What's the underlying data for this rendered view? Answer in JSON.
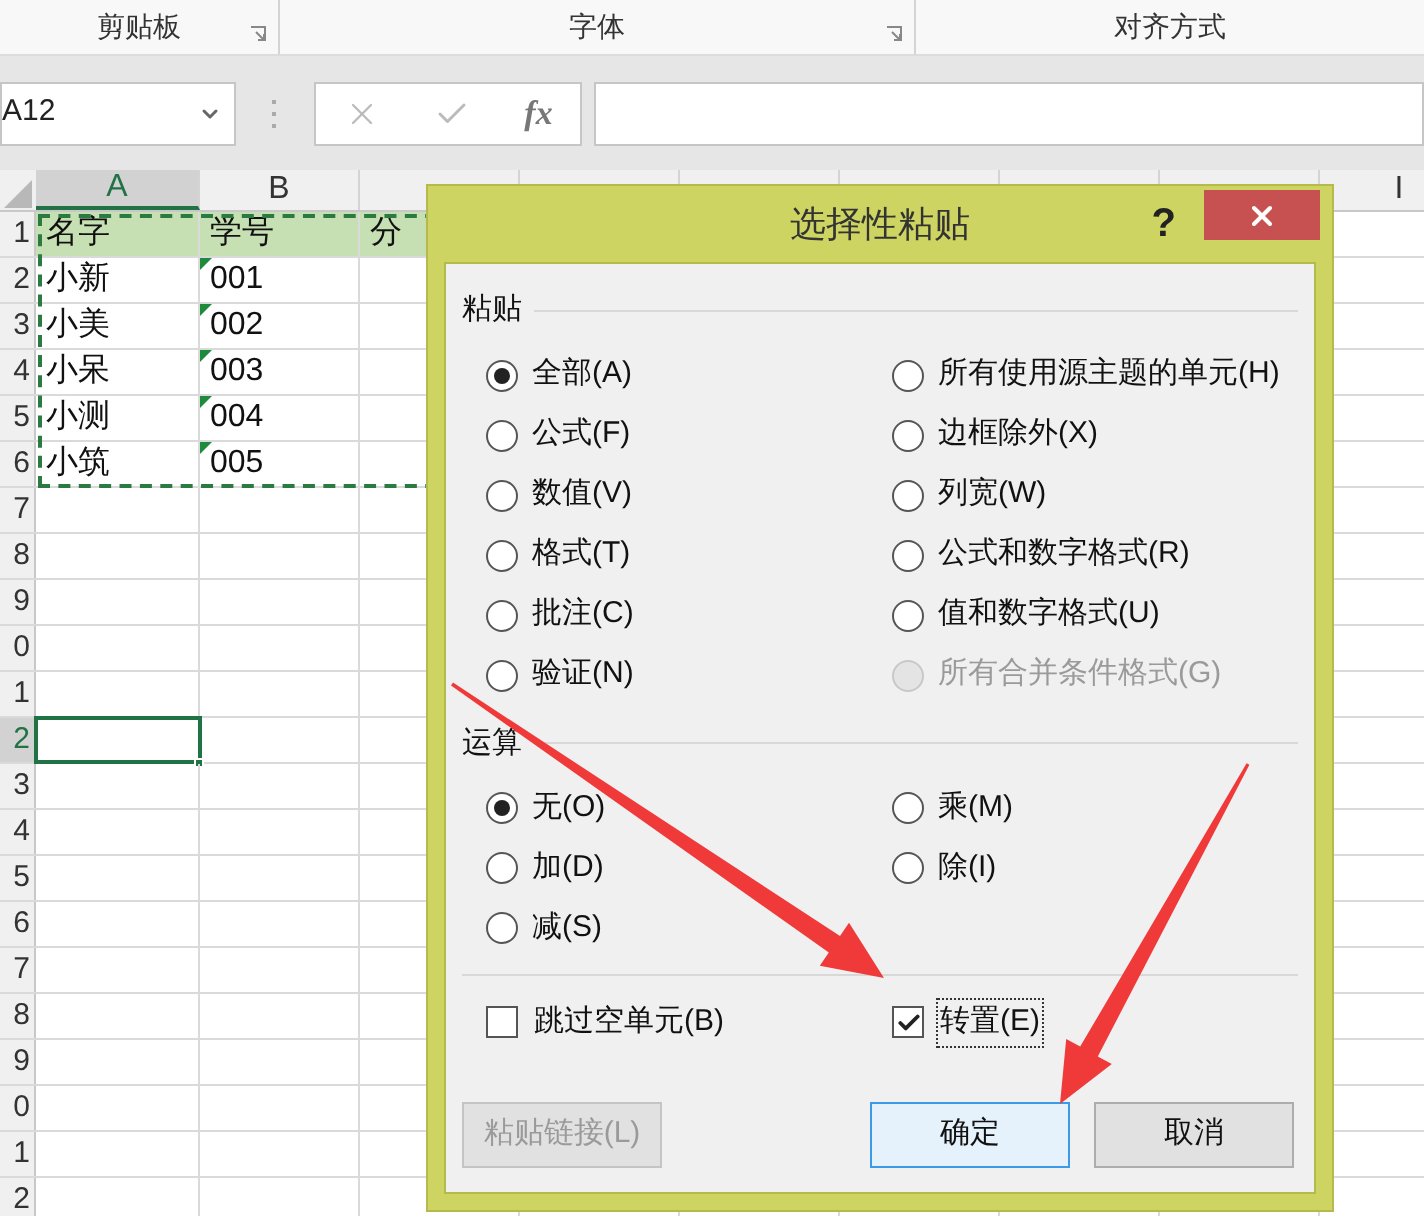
{
  "ribbon_groups": [
    {
      "label": "剪贴板",
      "launcher": true
    },
    {
      "label": "字体",
      "launcher": true
    },
    {
      "label": "对齐方式",
      "launcher": false
    }
  ],
  "formula_bar": {
    "name_box": "A12",
    "function_label": "fx"
  },
  "columns": [
    {
      "label": "A",
      "selected": true
    },
    {
      "label": "B",
      "selected": false
    },
    {
      "selected": false
    },
    {
      "selected": false
    },
    {
      "selected": false
    },
    {
      "selected": false
    },
    {
      "selected": false
    },
    {
      "selected": false
    },
    {
      "label": "I",
      "selected": false
    }
  ],
  "rows": [
    {
      "number": "1",
      "selected": false,
      "highlighted": true,
      "cells": [
        {
          "text": "名字"
        },
        {
          "text": "学号"
        },
        {
          "text": "分"
        }
      ]
    },
    {
      "number": "2",
      "selected": false,
      "highlighted": false,
      "cells": [
        {
          "text": "小新",
          "flagged": false
        },
        {
          "text": "001",
          "flagged": true
        }
      ]
    },
    {
      "number": "3",
      "selected": false,
      "highlighted": false,
      "cells": [
        {
          "text": "小美",
          "flagged": false
        },
        {
          "text": "002",
          "flagged": true
        }
      ]
    },
    {
      "number": "4",
      "selected": false,
      "highlighted": false,
      "cells": [
        {
          "text": "小呆",
          "flagged": false
        },
        {
          "text": "003",
          "flagged": true
        }
      ]
    },
    {
      "number": "5",
      "selected": false,
      "highlighted": false,
      "cells": [
        {
          "text": "小测",
          "flagged": false
        },
        {
          "text": "004",
          "flagged": true
        }
      ]
    },
    {
      "number": "6",
      "selected": false,
      "highlighted": false,
      "cells": [
        {
          "text": "小筑",
          "flagged": false
        },
        {
          "text": "005",
          "flagged": true
        }
      ]
    },
    {
      "number": "7",
      "selected": false,
      "highlighted": false,
      "cells": []
    },
    {
      "number": "8",
      "selected": false,
      "highlighted": false,
      "cells": []
    },
    {
      "number": "9",
      "selected": false,
      "highlighted": false,
      "cells": []
    },
    {
      "number": "0",
      "selected": false,
      "highlighted": false,
      "cells": []
    },
    {
      "number": "1",
      "selected": false,
      "highlighted": false,
      "cells": []
    },
    {
      "number": "2",
      "selected": true,
      "highlighted": false,
      "cells": []
    },
    {
      "number": "3",
      "selected": false,
      "highlighted": false,
      "cells": []
    },
    {
      "number": "4",
      "selected": false,
      "highlighted": false,
      "cells": []
    },
    {
      "number": "5",
      "selected": false,
      "highlighted": false,
      "cells": []
    },
    {
      "number": "6",
      "selected": false,
      "highlighted": false,
      "cells": []
    },
    {
      "number": "7",
      "selected": false,
      "highlighted": false,
      "cells": []
    },
    {
      "number": "8",
      "selected": false,
      "highlighted": false,
      "cells": []
    },
    {
      "number": "9",
      "selected": false,
      "highlighted": false,
      "cells": []
    },
    {
      "number": "0",
      "selected": false,
      "highlighted": false,
      "cells": []
    },
    {
      "number": "1",
      "selected": false,
      "highlighted": false,
      "cells": []
    },
    {
      "number": "2",
      "selected": false,
      "highlighted": false,
      "cells": []
    }
  ],
  "dialog": {
    "title": "选择性粘贴",
    "help": "?",
    "sections": [
      {
        "title": "粘贴",
        "options": [
          {
            "label": "全部(A)",
            "selected": true,
            "disabled": false
          },
          {
            "label": "所有使用源主题的单元(H)",
            "selected": false,
            "disabled": false
          },
          {
            "label": "公式(F)",
            "selected": false,
            "disabled": false
          },
          {
            "label": "边框除外(X)",
            "selected": false,
            "disabled": false
          },
          {
            "label": "数值(V)",
            "selected": false,
            "disabled": false
          },
          {
            "label": "列宽(W)",
            "selected": false,
            "disabled": false
          },
          {
            "label": "格式(T)",
            "selected": false,
            "disabled": false
          },
          {
            "label": "公式和数字格式(R)",
            "selected": false,
            "disabled": false
          },
          {
            "label": "批注(C)",
            "selected": false,
            "disabled": false
          },
          {
            "label": "值和数字格式(U)",
            "selected": false,
            "disabled": false
          },
          {
            "label": "验证(N)",
            "selected": false,
            "disabled": false
          },
          {
            "label": "所有合并条件格式(G)",
            "selected": false,
            "disabled": true
          }
        ]
      },
      {
        "title": "运算",
        "options": [
          {
            "label": "无(O)",
            "selected": true,
            "disabled": false
          },
          {
            "label": "乘(M)",
            "selected": false,
            "disabled": false
          },
          {
            "label": "加(D)",
            "selected": false,
            "disabled": false
          },
          {
            "label": "除(I)",
            "selected": false,
            "disabled": false
          },
          {
            "label": "减(S)",
            "selected": false,
            "disabled": false
          }
        ]
      }
    ],
    "checkboxes": [
      {
        "label": "跳过空单元(B)",
        "checked": false,
        "focused": false
      },
      {
        "label": "转置(E)",
        "checked": true,
        "focused": true
      }
    ],
    "buttons": [
      {
        "label": "粘贴链接(L)",
        "disabled": true,
        "default": false
      },
      {
        "label": "确定",
        "disabled": false,
        "default": true
      },
      {
        "label": "取消",
        "disabled": false,
        "default": false
      }
    ]
  }
}
